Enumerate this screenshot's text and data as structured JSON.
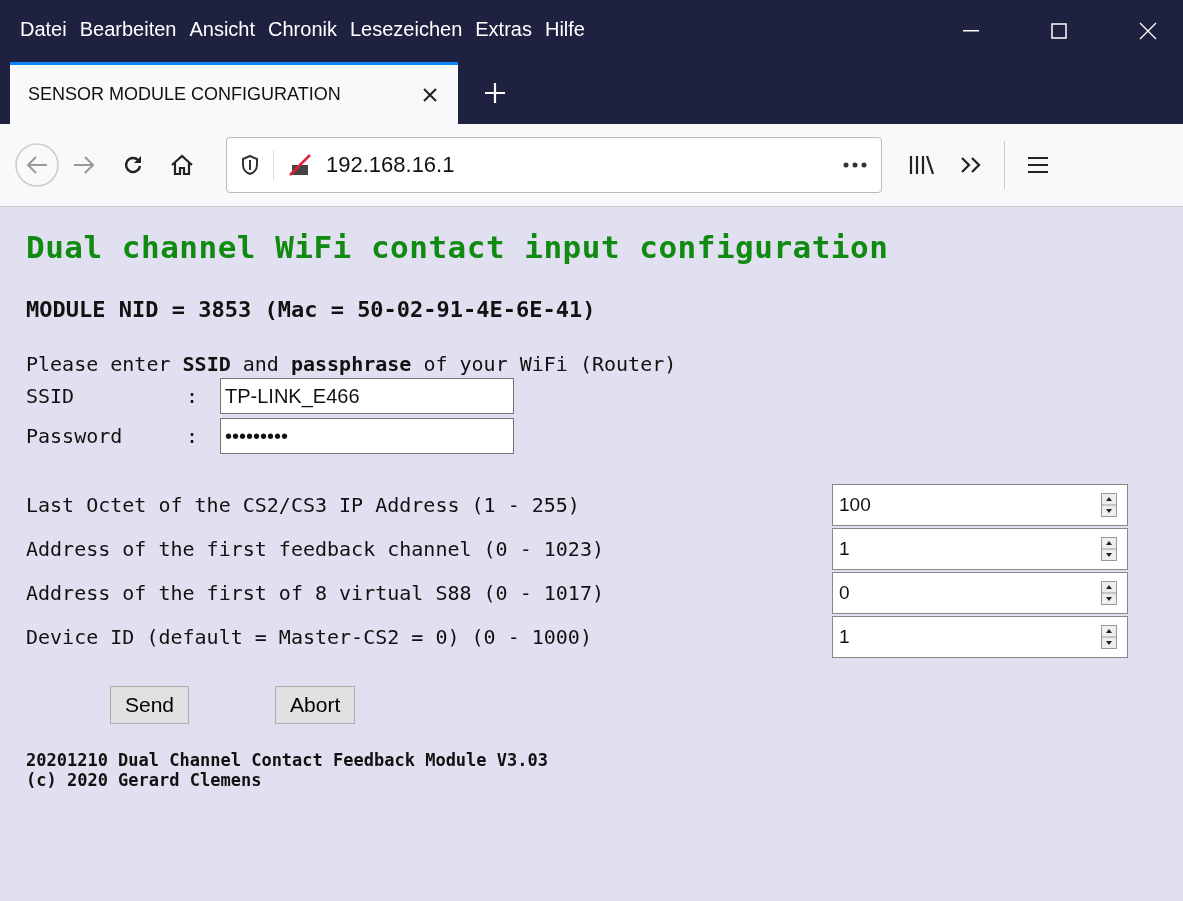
{
  "menu_bar": {
    "items": [
      "Datei",
      "Bearbeiten",
      "Ansicht",
      "Chronik",
      "Lesezeichen",
      "Extras",
      "Hilfe"
    ]
  },
  "tabs": [
    {
      "label": "SENSOR MODULE CONFIGURATION",
      "selected": true
    }
  ],
  "address_bar": {
    "url": "192.168.16.1"
  },
  "page": {
    "heading": "Dual channel WiFi contact input configuration",
    "module_line": "MODULE NID = 3853 (Mac = 50-02-91-4E-6E-41)",
    "intro": "Please enter **SSID** and **passphrase** of your WiFi (Router)",
    "credentials": [
      {
        "label": "SSID",
        "separator": ":",
        "value": "TP-LINK_E466"
      },
      {
        "label": "Password",
        "separator": ":",
        "value": "•••••••••"
      }
    ],
    "number_fields": [
      {
        "label": "Last Octet of the CS2/CS3 IP Address (1 - 255)",
        "value": "100"
      },
      {
        "label": "Address of the first feedback channel (0 - 1023)",
        "value": "1"
      },
      {
        "label": "Address of the first of 8 virtual S88 (0 - 1017)",
        "value": "0"
      },
      {
        "label": "Device ID (default = Master-CS2 = 0) (0 - 1000)",
        "value": "1"
      }
    ],
    "buttons": [
      "Send",
      "Abort"
    ],
    "footer": [
      "20201210 Dual Channel Contact Feedback Module V3.03",
      "(c) 2020 Gerard Clemens"
    ]
  }
}
